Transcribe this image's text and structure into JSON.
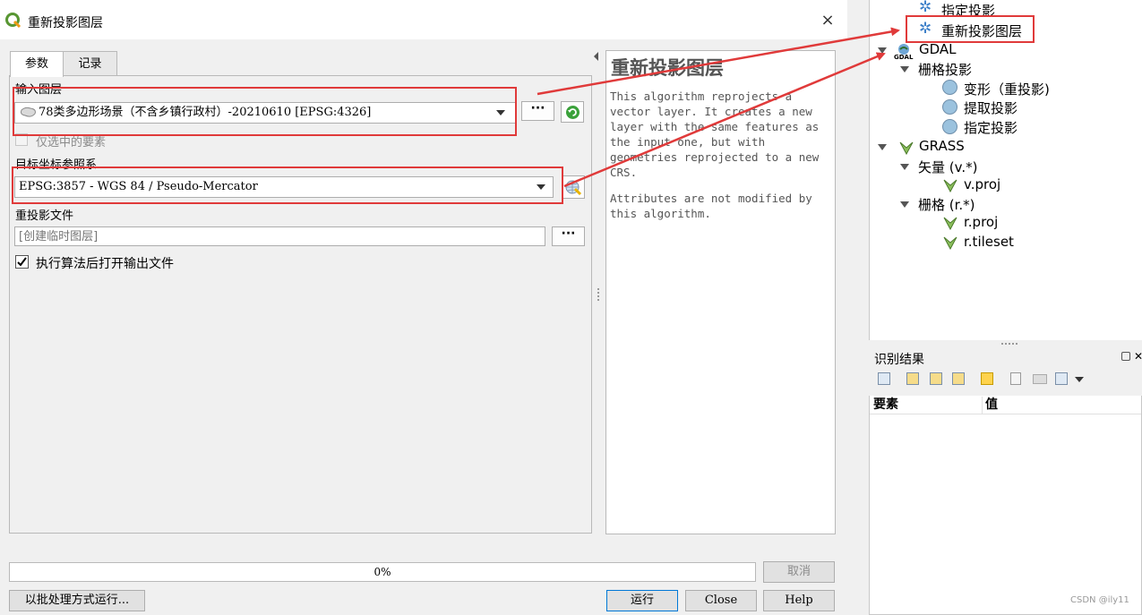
{
  "dialog": {
    "title": "重新投影图层",
    "close_icon": "×",
    "tabs": [
      {
        "label": "参数"
      },
      {
        "label": "记录"
      }
    ],
    "input_layer": {
      "label": "输入图层",
      "value": "78类多边形场景（不含乡镇行政村）-20210610 [EPSG:4326]",
      "dots_label": "···"
    },
    "selected_only": {
      "label": "仅选中的要素",
      "checked": false
    },
    "target_crs": {
      "label": "目标坐标参照系",
      "value": "EPSG:3857 - WGS 84 / Pseudo-Mercator"
    },
    "reprojected": {
      "label": "重投影文件",
      "placeholder": "[创建临时图层]",
      "dots_label": "···"
    },
    "open_output": {
      "label": "执行算法后打开输出文件",
      "checked": true
    },
    "help": {
      "title": "重新投影图层",
      "paragraph1": "This algorithm reprojects a vector layer. It creates a new layer with the same features as the input one, but with geometries reprojected to a new CRS.",
      "paragraph2": "Attributes are not modified by this algorithm."
    },
    "progress": {
      "text": "0%",
      "value": 0
    },
    "buttons": {
      "cancel": "取消",
      "batch": "以批处理方式运行...",
      "run": "运行",
      "close": "Close",
      "help": "Help"
    },
    "accent_color": "#e03a3a"
  },
  "toolbox": {
    "items": [
      {
        "label": "指定投影"
      },
      {
        "label": "重新投影图层"
      },
      {
        "label": "GDAL"
      },
      {
        "label": "栅格投影"
      },
      {
        "label": "变形（重投影)"
      },
      {
        "label": "提取投影"
      },
      {
        "label": "指定投影"
      },
      {
        "label": "GRASS"
      },
      {
        "label": "矢量 (v.*)"
      },
      {
        "label": "v.proj"
      },
      {
        "label": "栅格 (r.*)"
      },
      {
        "label": "r.proj"
      },
      {
        "label": "r.tileset"
      }
    ],
    "gdal_badge": "GDAL"
  },
  "identify": {
    "title": "识别结果",
    "columns": [
      "要素",
      "值"
    ]
  },
  "watermark": "CSDN @ily11"
}
